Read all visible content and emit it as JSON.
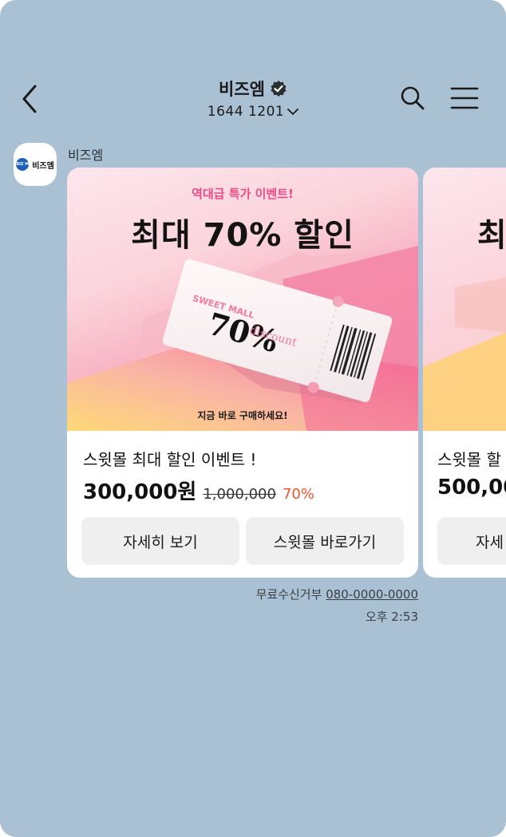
{
  "header": {
    "title": "비즈엠",
    "phone": "1644  1201"
  },
  "sender": {
    "name": "비즈엠",
    "avatar_badge": "BIZ M",
    "avatar_text": "비즈엠"
  },
  "card": {
    "banner_subtitle": "역대급 특가 이벤트!",
    "banner_headline": "최대 70% 할인",
    "ticket_brand": "SWEET MALL",
    "ticket_percent": "70%",
    "ticket_word": "discount",
    "banner_footer": "지금 바로 구매하세요!",
    "title": "스윗몰 최대 할인 이벤트 !",
    "price": "300,000원",
    "original_price": "1,000,000",
    "discount": "70%",
    "buttons": [
      "자세히 보기",
      "스윗몰 바로가기"
    ]
  },
  "card2": {
    "banner_headline": "최",
    "title": "스윗몰 할",
    "price": "500,00",
    "button": "자세"
  },
  "footer": {
    "optout_label": "무료수신거부",
    "optout_number": "080-0000-0000",
    "time": "오후 2:53"
  },
  "colors": {
    "background": "#aac0d3",
    "accent_pink": "#ee4a86",
    "discount_red": "#f0522a"
  }
}
